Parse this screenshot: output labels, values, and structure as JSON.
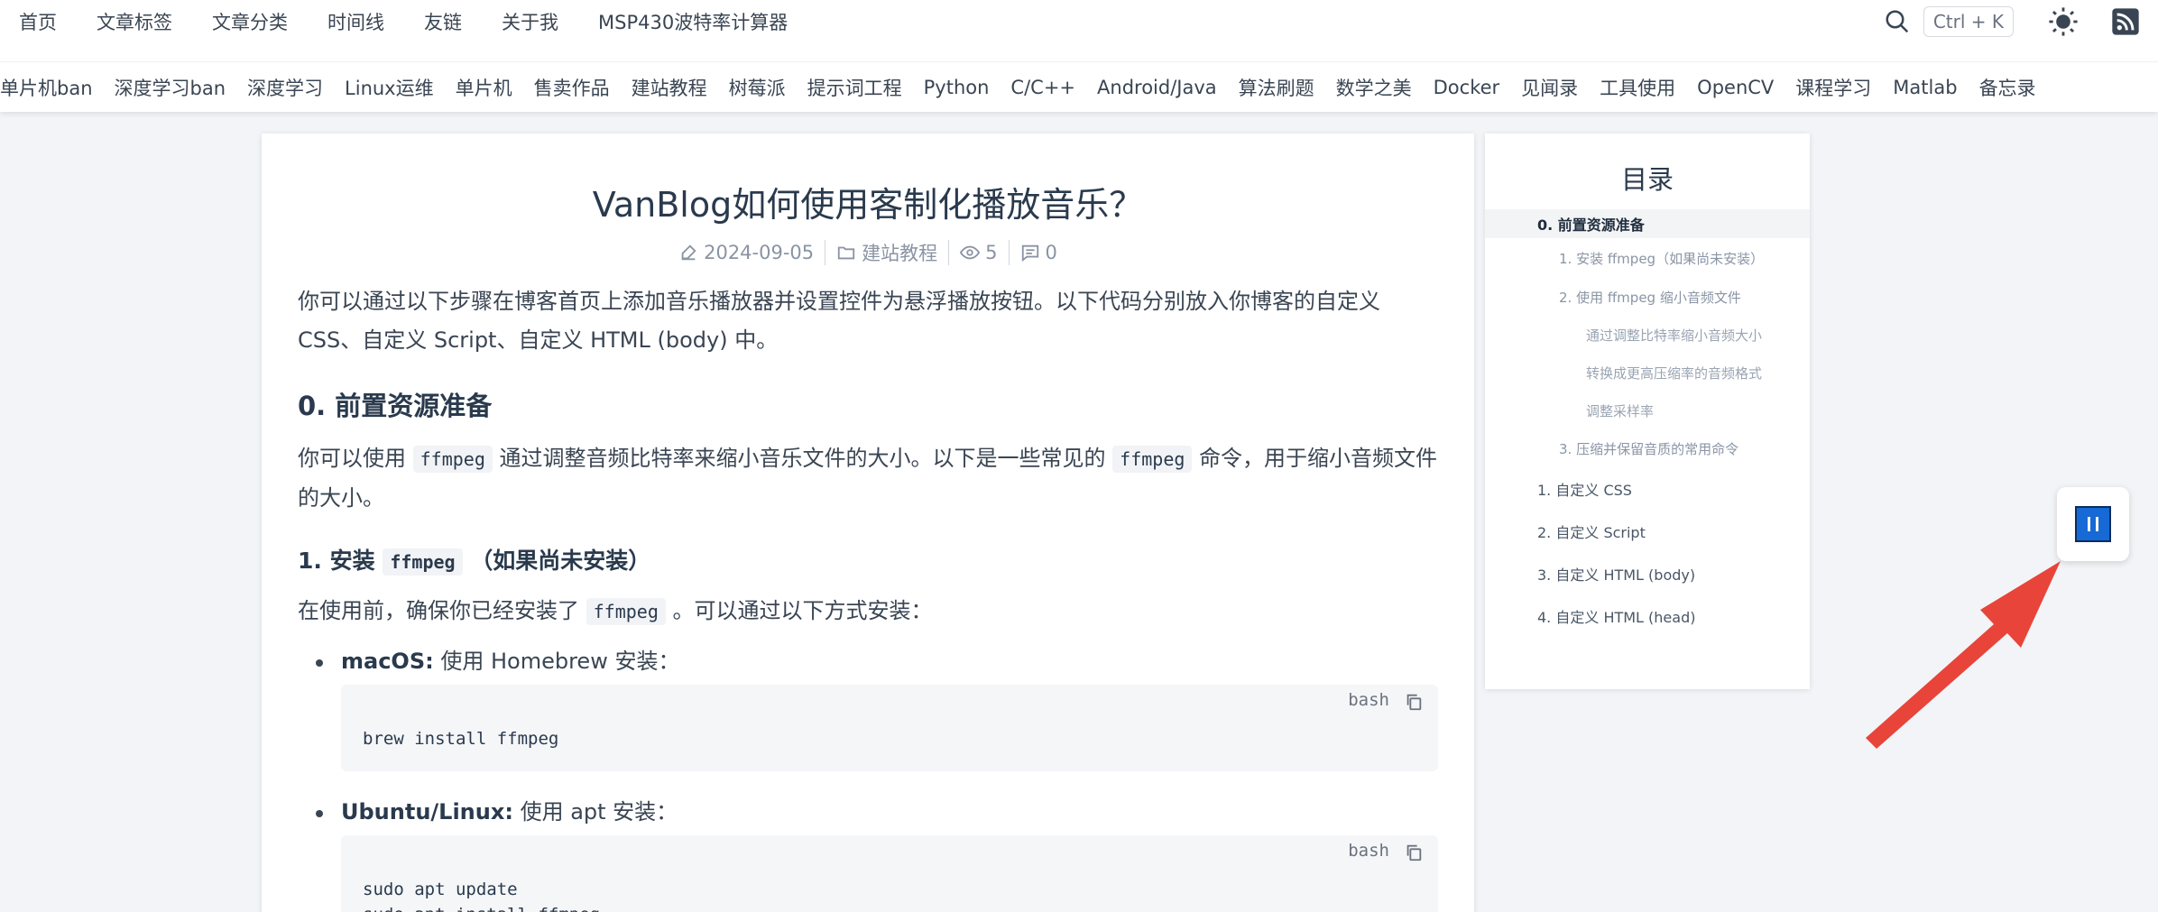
{
  "nav": {
    "main": [
      "首页",
      "文章标签",
      "文章分类",
      "时间线",
      "友链",
      "关于我",
      "MSP430波特率计算器"
    ],
    "search_shortcut": "Ctrl + K",
    "categories": [
      "单片机ban",
      "深度学习ban",
      "深度学习",
      "Linux运维",
      "单片机",
      "售卖作品",
      "建站教程",
      "树莓派",
      "提示词工程",
      "Python",
      "C/C++",
      "Android/Java",
      "算法刷题",
      "数学之美",
      "Docker",
      "见闻录",
      "工具使用",
      "OpenCV",
      "课程学习",
      "Matlab",
      "备忘录"
    ]
  },
  "article": {
    "title": "VanBlog如何使用客制化播放音乐？",
    "date": "2024-09-05",
    "category": "建站教程",
    "views": "5",
    "comments": "0",
    "intro": "你可以通过以下步骤在博客首页上添加音乐播放器并设置控件为悬浮播放按钮。以下代码分别放入你博客的自定义 CSS、自定义 Script、自定义 HTML (body) 中。",
    "h2_prep": "0. 前置资源准备",
    "prep_text_1": "你可以使用",
    "prep_code_1": "ffmpeg",
    "prep_text_2": "通过调整音频比特率来缩小音乐文件的大小。以下是一些常见的",
    "prep_code_2": "ffmpeg",
    "prep_text_3": "命令，用于缩小音频文件的大小。",
    "h3_install_prefix": "1. 安装",
    "h3_install_code": "ffmpeg",
    "h3_install_suffix": "（如果尚未安装）",
    "install_text_1": "在使用前，确保你已经安装了",
    "install_code": "ffmpeg",
    "install_text_2": "。可以通过以下方式安装：",
    "mac_label": "macOS:",
    "mac_text": "使用 Homebrew 安装：",
    "mac_lang": "bash",
    "mac_code": "brew install ffmpeg",
    "linux_label": "Ubuntu/Linux:",
    "linux_text": "使用 apt 安装：",
    "linux_lang": "bash",
    "linux_code_1": "sudo apt update",
    "linux_code_2": "sudo apt install ffmpeg"
  },
  "toc": {
    "title": "目录",
    "items": [
      "0. 前置资源准备",
      "1. 安装 ffmpeg（如果尚未安装）",
      "2. 使用 ffmpeg 缩小音频文件",
      "通过调整比特率缩小音频大小",
      "转换成更高压缩率的音频格式",
      "调整采样率",
      "3. 压缩并保留音质的常用命令",
      "1. 自定义 CSS",
      "2. 自定义 Script",
      "3. 自定义 HTML (body)",
      "4. 自定义 HTML (head)"
    ]
  },
  "colors": {
    "accent": "#1769d6",
    "arrow": "#e8443a",
    "background": "#f2f4f7"
  }
}
